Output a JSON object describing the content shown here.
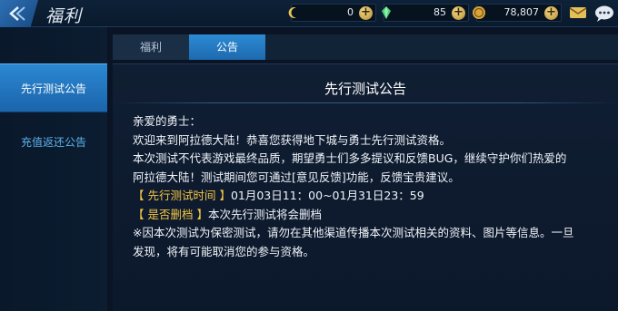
{
  "header": {
    "title": "福利",
    "resources": [
      {
        "icon": "crescent-coin-icon",
        "value": "0"
      },
      {
        "icon": "green-crystal-icon",
        "value": "85"
      },
      {
        "icon": "gold-coin-icon",
        "value": "78,807"
      }
    ],
    "plus_label": "+"
  },
  "sidebar": {
    "items": [
      {
        "label": "先行测试公告",
        "active": true
      },
      {
        "label": "充值返还公告",
        "active": false
      }
    ]
  },
  "tabs": [
    {
      "label": "福利",
      "active": false
    },
    {
      "label": "公告",
      "active": true
    }
  ],
  "announcement": {
    "title": "先行测试公告",
    "greeting": "亲爱的勇士：",
    "line1": "欢迎来到阿拉德大陆！恭喜您获得地下城与勇士先行测试资格。",
    "line2": "本次测试不代表游戏最终品质，期望勇士们多多提议和反馈BUG，继续守护你们热爱的",
    "line3": "阿拉德大陆！测试期间您可通过[意见反馈]功能，反馈宝贵建议。",
    "time_label": "【 先行测试时间 】",
    "time_value": "01月03日11：00~01月31日23：59",
    "delete_label": "【 是否删档 】",
    "delete_value": "本次先行测试将会删档",
    "note1": "※因本次测试为保密测试，请勿在其他渠道传播本次测试相关的资料、图片等信息。一旦",
    "note2": "发现，将有可能取消您的参与资格。"
  },
  "colors": {
    "accent_blue": "#2b87d2",
    "highlight_yellow": "#f4c542",
    "background": "#0a1424"
  }
}
